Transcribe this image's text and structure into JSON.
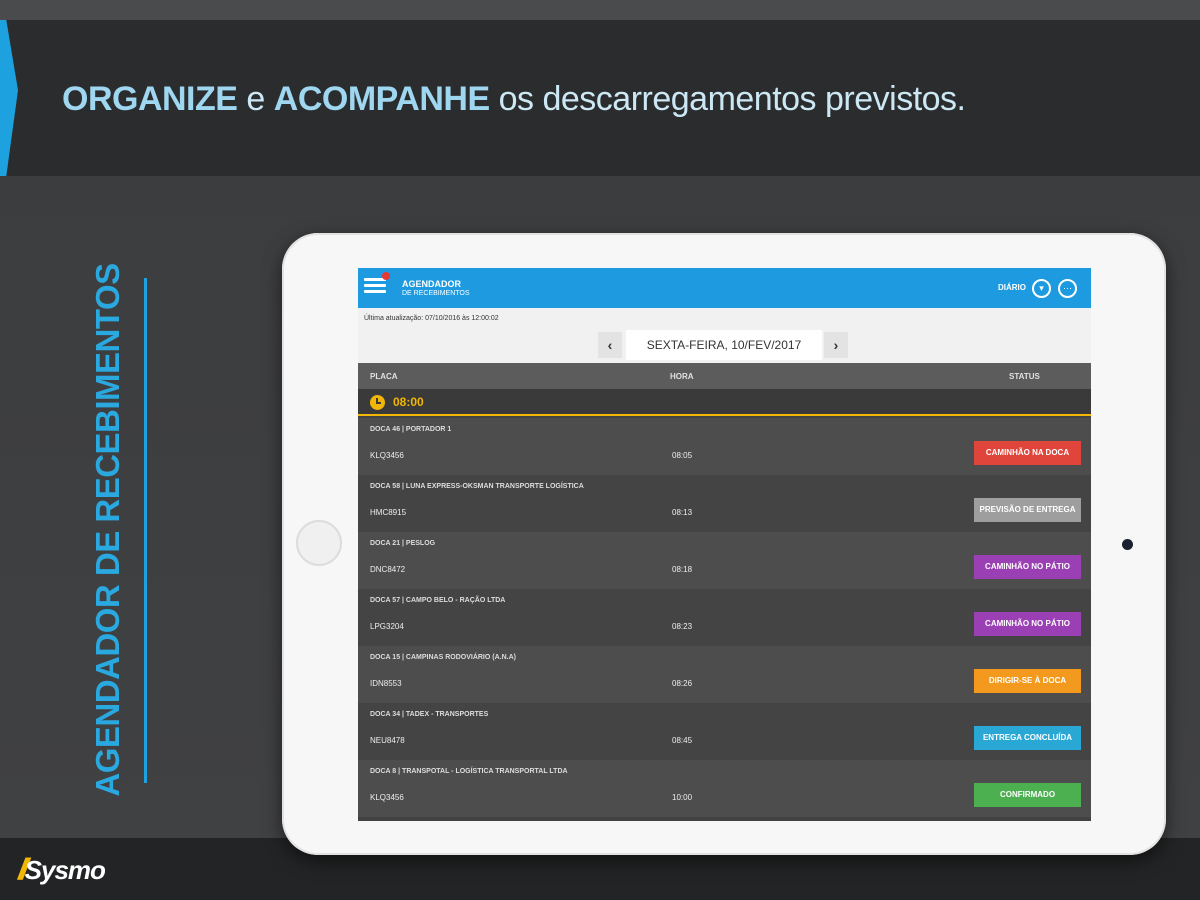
{
  "headline": {
    "w1": "ORGANIZE",
    "w2": "e",
    "w3": "ACOMPANHE",
    "w4": "os descarregamentos previstos."
  },
  "side_title": "AGENDADOR DE RECEBIMENTOS",
  "brand": {
    "mark": "//",
    "name": "Sysmo"
  },
  "app": {
    "title_line1": "AGENDADOR",
    "title_line2": "DE RECEBIMENTOS",
    "view_label": "DIÁRIO",
    "filter_icon": "filter-dropdown-icon",
    "more_icon": "more-options-icon",
    "last_update": "Última atualização: 07/10/2016 às 12:00:02",
    "date": "SEXTA-FEIRA, 10/FEV/2017",
    "prev": "‹",
    "next": "›"
  },
  "table": {
    "headers": {
      "plate": "PLACA",
      "hour": "HORA",
      "status": "STATUS"
    },
    "group_time": "08:00",
    "rows": [
      {
        "dock": "DOCA 46 | PORTADOR 1",
        "plate": "KLQ3456",
        "hour": "08:05",
        "status": "CAMINHÃO NA DOCA",
        "color": "#e0453b"
      },
      {
        "dock": "DOCA 58 | LUNA EXPRESS-OKSMAN TRANSPORTE LOGÍSTICA",
        "plate": "HMC8915",
        "hour": "08:13",
        "status": "PREVISÃO DE ENTREGA",
        "color": "#9e9e9e"
      },
      {
        "dock": "DOCA 21 | PESLOG",
        "plate": "DNC8472",
        "hour": "08:18",
        "status": "CAMINHÃO NO PÁTIO",
        "color": "#9b3fb5"
      },
      {
        "dock": "DOCA 57 | CAMPO BELO - RAÇÃO LTDA",
        "plate": "LPG3204",
        "hour": "08:23",
        "status": "CAMINHÃO NO PÁTIO",
        "color": "#9b3fb5"
      },
      {
        "dock": "DOCA 15 | CAMPINAS RODOVIÁRIO (A.N.A)",
        "plate": "IDN8553",
        "hour": "08:26",
        "status": "DIRIGIR-SE À DOCA",
        "color": "#f39a1e"
      },
      {
        "dock": "DOCA 34 | TADEX - TRANSPORTES",
        "plate": "NEU8478",
        "hour": "08:45",
        "status": "ENTREGA CONCLUÍDA",
        "color": "#29a8d6"
      },
      {
        "dock": "DOCA 8 | TRANSPOTAL - LOGÍSTICA TRANSPORTAL LTDA",
        "plate": "KLQ3456",
        "hour": "10:00",
        "status": "CONFIRMADO",
        "color": "#4caf50"
      }
    ]
  }
}
